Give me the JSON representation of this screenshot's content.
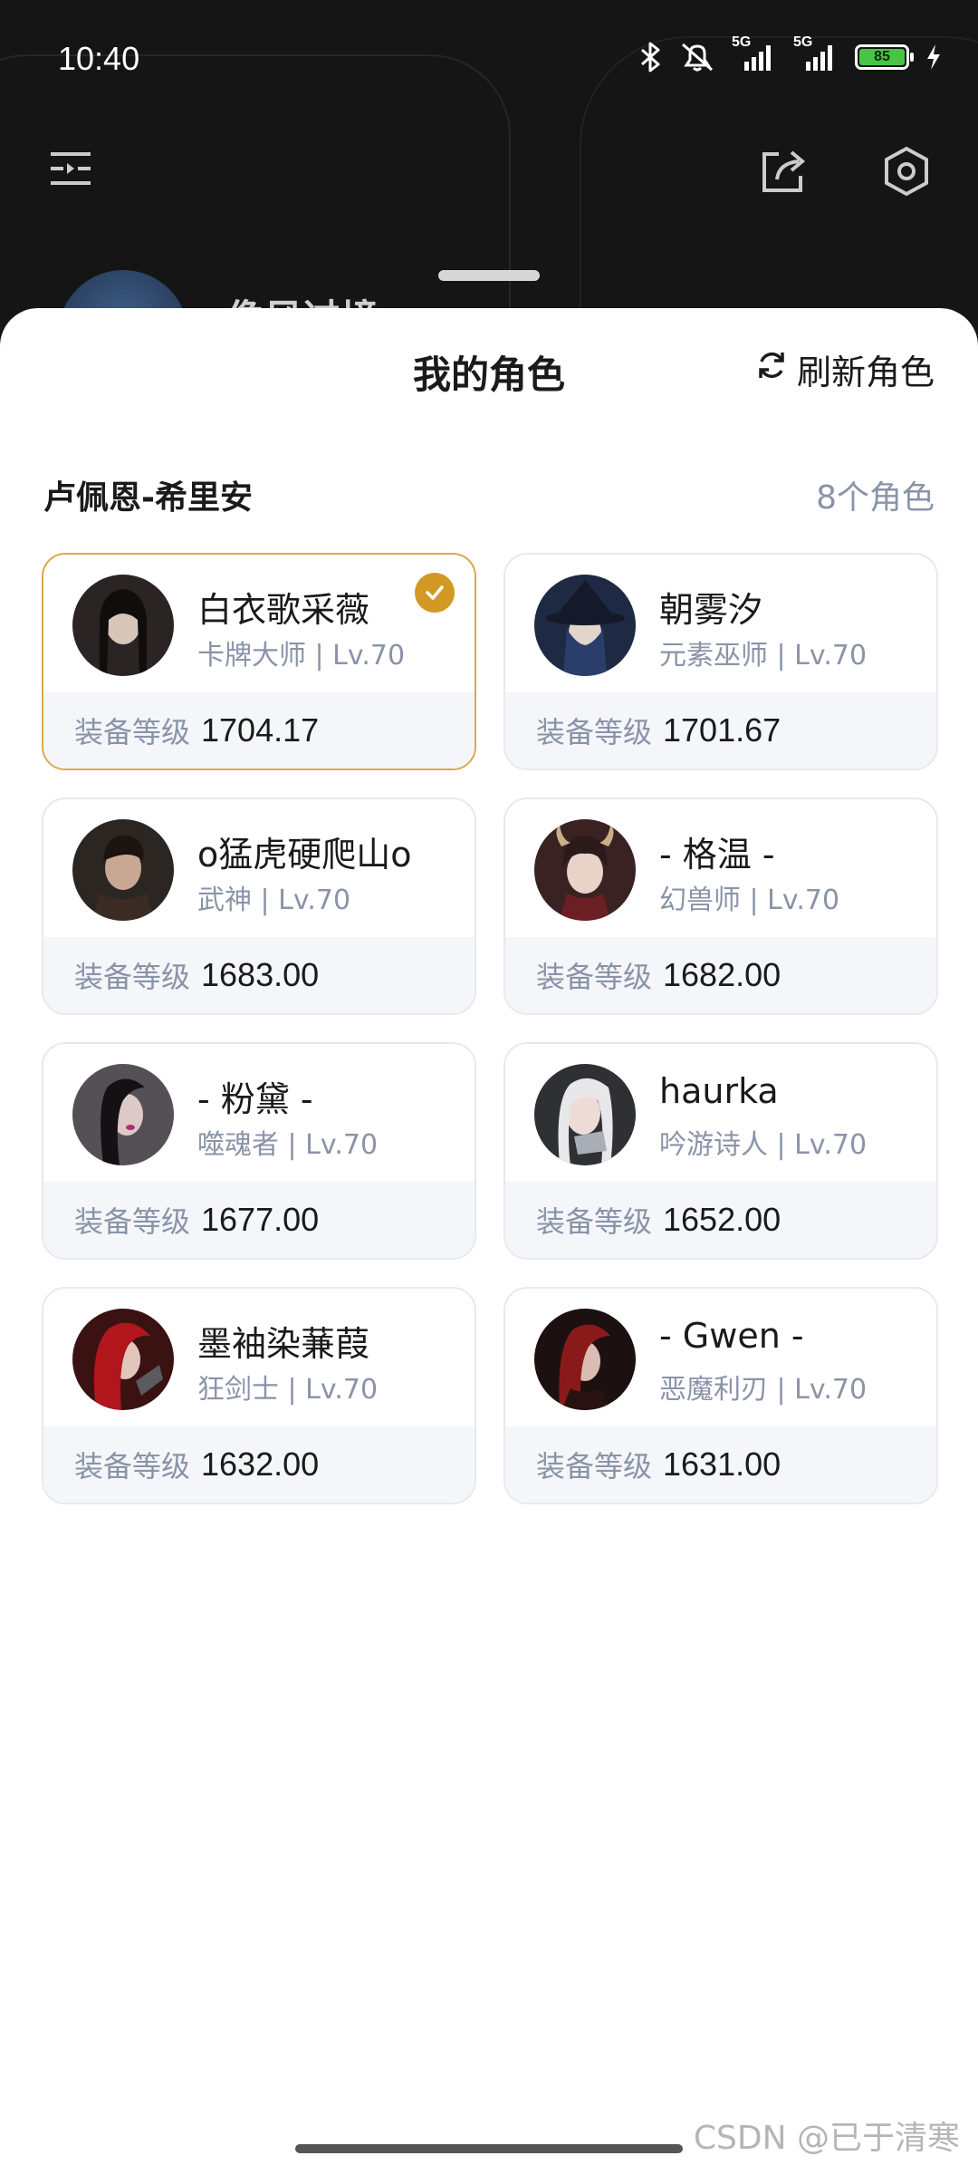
{
  "status_bar": {
    "time": "10:40",
    "network_labels": [
      "5G",
      "5G"
    ],
    "battery": "85",
    "icons": [
      "bluetooth-icon",
      "mute-icon",
      "signal-icon",
      "signal-icon",
      "battery-icon",
      "charging-icon"
    ]
  },
  "background": {
    "name_partial": "像风过境"
  },
  "sheet": {
    "title": "我的角色",
    "refresh_label": "刷新角色",
    "server": "卢佩恩-希里安",
    "count": "8个角色",
    "gear_label": "装备等级",
    "characters": [
      {
        "name": "白衣歌采薇",
        "meta": "卡牌大师 | Lv.70",
        "gear": "1704.17",
        "selected": true,
        "avatar_color": "#3a2f2c"
      },
      {
        "name": "朝雾汐",
        "meta": "元素巫师 | Lv.70",
        "gear": "1701.67",
        "selected": false,
        "avatar_color": "#2c3a5a"
      },
      {
        "name": "o猛虎硬爬山o",
        "meta": "武神 | Lv.70",
        "gear": "1683.00",
        "selected": false,
        "avatar_color": "#3a332e"
      },
      {
        "name": "- 格温 -",
        "meta": "幻兽师 | Lv.70",
        "gear": "1682.00",
        "selected": false,
        "avatar_color": "#5a2a2a"
      },
      {
        "name": "- 粉黛 -",
        "meta": "噬魂者 | Lv.70",
        "gear": "1677.00",
        "selected": false,
        "avatar_color": "#2e2a30"
      },
      {
        "name": "haurka",
        "meta": "吟游诗人 | Lv.70",
        "gear": "1652.00",
        "selected": false,
        "avatar_color": "#8c8e95"
      },
      {
        "name": "墨袖染蒹葭",
        "meta": "狂剑士 | Lv.70",
        "gear": "1632.00",
        "selected": false,
        "avatar_color": "#7a1a1a"
      },
      {
        "name": "- Gwen -",
        "meta": "恶魔利刃 | Lv.70",
        "gear": "1631.00",
        "selected": false,
        "avatar_color": "#5a1414"
      }
    ]
  },
  "watermark": "CSDN @已于清寒"
}
